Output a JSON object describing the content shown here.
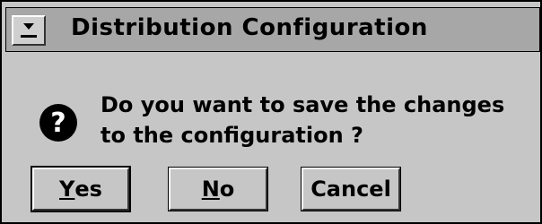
{
  "window": {
    "title": "Distribution Configuration",
    "system_menu_icon": "minimize-arrow-icon"
  },
  "dialog": {
    "icon": "question-icon",
    "icon_glyph": "?",
    "message": "Do you want to save the changes to the configuration ?"
  },
  "buttons": {
    "yes": {
      "mnemonic": "Y",
      "rest": "es"
    },
    "no": {
      "mnemonic": "N",
      "rest": "o"
    },
    "cancel": {
      "label": "Cancel"
    }
  },
  "colors": {
    "dialog_bg": "#c6c6c6",
    "titlebar_bg": "#a7a7a7",
    "text": "#000000"
  }
}
